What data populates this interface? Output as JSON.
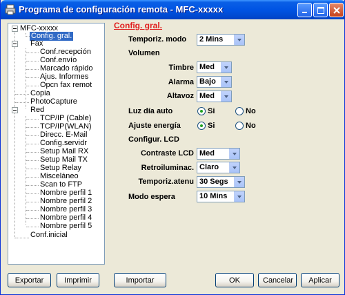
{
  "window": {
    "title": "Programa de configuración remota - MFC-xxxxx"
  },
  "tree": {
    "root": "MFC-xxxxx",
    "items": [
      {
        "label": "Config. gral.",
        "selected": true
      },
      {
        "label": "Fax"
      },
      {
        "label": "Conf.recepción"
      },
      {
        "label": "Conf.envío"
      },
      {
        "label": "Marcado rápido"
      },
      {
        "label": "Ajus. Informes"
      },
      {
        "label": "Opcn fax remot"
      },
      {
        "label": "Copia"
      },
      {
        "label": "PhotoCapture"
      },
      {
        "label": "Red"
      },
      {
        "label": "TCP/IP (Cable)"
      },
      {
        "label": "TCP/IP(WLAN)"
      },
      {
        "label": "Direcc. E-Mail"
      },
      {
        "label": "Config.servidr"
      },
      {
        "label": "Setup Mail RX"
      },
      {
        "label": "Setup Mail TX"
      },
      {
        "label": "Setup Relay"
      },
      {
        "label": "Misceláneo"
      },
      {
        "label": "Scan to FTP"
      },
      {
        "label": "Nombre perfil 1"
      },
      {
        "label": "Nombre perfil 2"
      },
      {
        "label": "Nombre perfil 3"
      },
      {
        "label": "Nombre perfil 4"
      },
      {
        "label": "Nombre perfil 5"
      },
      {
        "label": "Conf.inicial"
      }
    ]
  },
  "panel": {
    "title": "Config. gral.",
    "temporiz_modo": {
      "label": "Temporiz. modo",
      "value": "2 Mins"
    },
    "volumen_heading": "Volumen",
    "timbre": {
      "label": "Timbre",
      "value": "Med"
    },
    "alarma": {
      "label": "Alarma",
      "value": "Bajo"
    },
    "altavoz": {
      "label": "Altavoz",
      "value": "Med"
    },
    "luz_dia": {
      "label": "Luz día auto",
      "opt_yes": "Si",
      "opt_no": "No",
      "selected": "Si"
    },
    "ajuste_energia": {
      "label": "Ajuste energía",
      "opt_yes": "Si",
      "opt_no": "No",
      "selected": "Si"
    },
    "lcd_heading": "Configur. LCD",
    "contraste": {
      "label": "Contraste LCD",
      "value": "Med"
    },
    "retroilum": {
      "label": "Retroiluminac.",
      "value": "Claro"
    },
    "temporiz_atenu": {
      "label": "Temporiz.atenu",
      "value": "30 Segs"
    },
    "modo_espera": {
      "label": "Modo espera",
      "value": "10 Mins"
    }
  },
  "buttons": {
    "exportar": "Exportar",
    "imprimir": "Imprimir",
    "importar": "Importar",
    "ok": "OK",
    "cancelar": "Cancelar",
    "aplicar": "Aplicar"
  }
}
